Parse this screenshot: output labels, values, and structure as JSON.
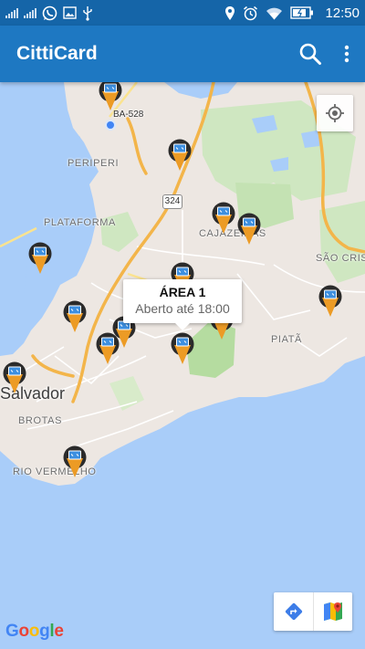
{
  "status_bar": {
    "time": "12:50",
    "icons": [
      "signal-icon",
      "signal-icon",
      "whatsapp-icon",
      "image-icon",
      "usb-icon",
      "location-icon",
      "alarm-icon",
      "wifi-icon",
      "battery-icon"
    ]
  },
  "app_bar": {
    "title": "CittiCard",
    "actions": [
      "search-icon",
      "more-vert-icon"
    ]
  },
  "map": {
    "labels": {
      "road_ba528": "BA-528",
      "road_324": "324",
      "periperi": "PERIPERI",
      "plataforma": "PLATAFORMA",
      "cajazeiras": "CAJAZEIRAS",
      "sao_cristovao": "SÃO CRIS",
      "piata": "PIATÃ",
      "salvador": "Salvador",
      "brotas": "BROTAS",
      "rio_vermelho": "RIO VERMELHO"
    },
    "info_window": {
      "title": "ÁREA 1",
      "subtitle": "Aberto até 18:00"
    },
    "marker_count": 16,
    "brand_colors": {
      "app_bar": "#1e78c2",
      "status_bar": "#1565a8",
      "marker_orange": "#ec9b25",
      "marker_dark": "#2b2b2b",
      "marker_screen": "#3d8fe0"
    },
    "attribution": "Google"
  }
}
